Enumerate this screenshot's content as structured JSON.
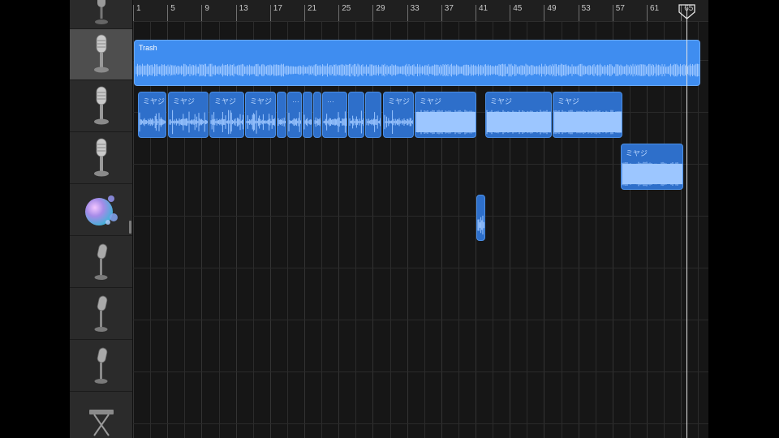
{
  "ruler": {
    "bars": [
      "1",
      "5",
      "9",
      "13",
      "17",
      "21",
      "25",
      "29",
      "33",
      "37",
      "41",
      "45",
      "49",
      "53",
      "57",
      "61",
      "65"
    ]
  },
  "tracks": [
    {
      "icon": "microphone-icon"
    },
    {
      "icon": "microphone-icon"
    },
    {
      "icon": "microphone-icon"
    },
    {
      "icon": "microphone-icon"
    },
    {
      "icon": "bubbles-instrument-icon"
    },
    {
      "icon": "microphone-icon"
    },
    {
      "icon": "microphone-icon"
    },
    {
      "icon": "microphone-icon"
    },
    {
      "icon": "keyboard-stand-icon"
    }
  ],
  "regions": {
    "r0": {
      "name": "Trash"
    },
    "r1": {
      "name": "ミヤジ"
    },
    "r2": {
      "name": "ミヤジ"
    },
    "r3": {
      "name": "ミヤジ"
    },
    "r4": {
      "name": "ミヤジ"
    },
    "r5": {
      "name": "…"
    },
    "r6": {
      "name": "…"
    },
    "r7": {
      "name": "ミヤジ"
    },
    "r8": {
      "name": "ミヤジ"
    },
    "r9": {
      "name": "ミヤジ"
    },
    "r10": {
      "name": "ミヤジ"
    },
    "r11": {
      "name": "ミヤジ"
    }
  },
  "colors": {
    "region": "#2e6fca",
    "region_selected": "#3f8df0",
    "waveform": "#9cc6ff",
    "playhead": "#e6e6e6"
  }
}
